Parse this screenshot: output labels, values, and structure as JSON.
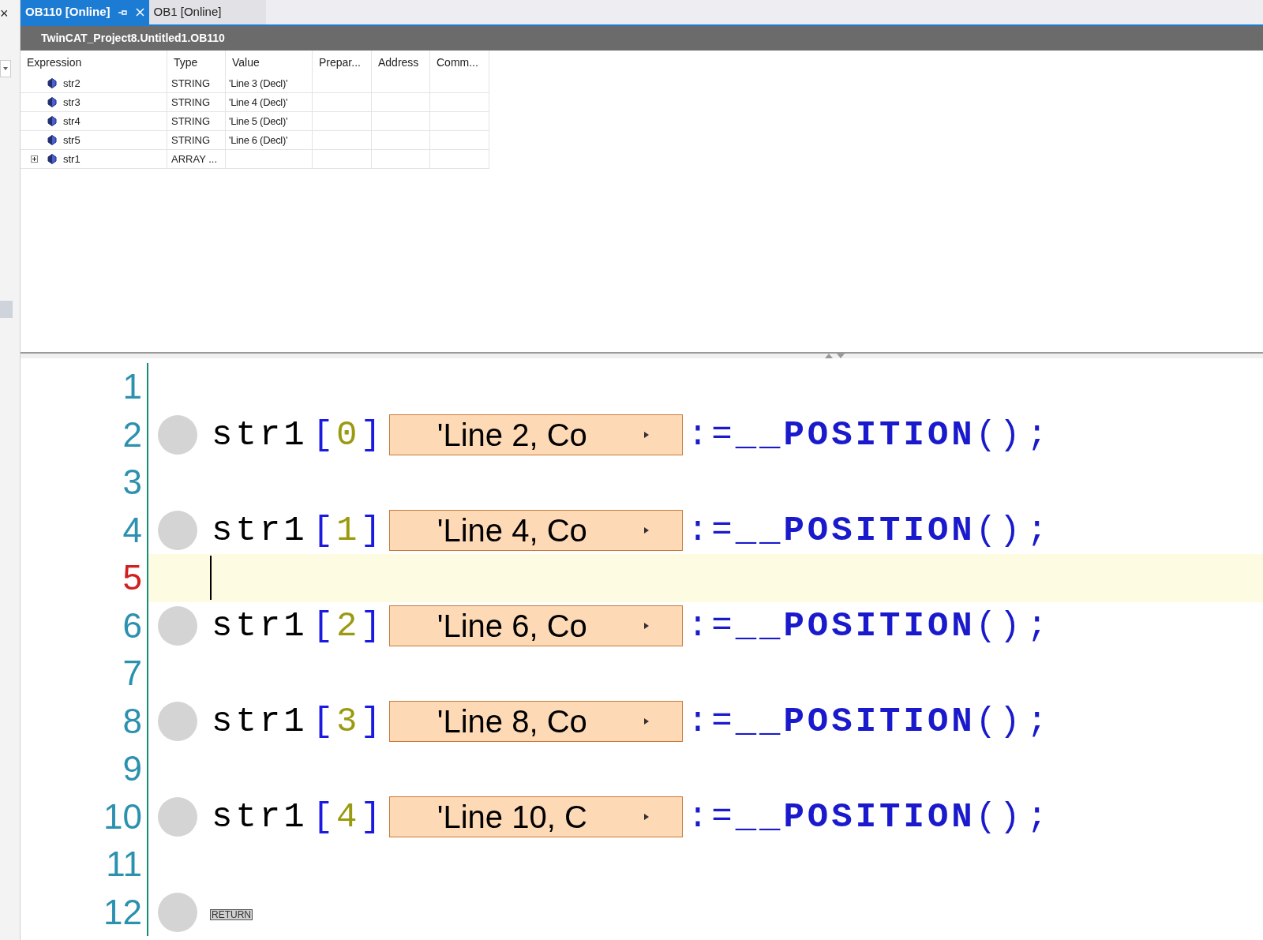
{
  "left_panel": {
    "close": "×"
  },
  "tabs": [
    {
      "label": "OB110 [Online]",
      "selected": true
    },
    {
      "label": "OB1 [Online]",
      "selected": false
    }
  ],
  "title_bar": {
    "title": "TwinCAT_Project8.Untitled1.OB110"
  },
  "watch_table": {
    "columns": [
      "Expression",
      "Type",
      "Value",
      "Prepar...",
      "Address",
      "Comm..."
    ],
    "rows": [
      {
        "expression": "str2",
        "type": "STRING",
        "value": "'Line 3 (Decl)'",
        "expandable": false
      },
      {
        "expression": "str3",
        "type": "STRING",
        "value": "'Line 4 (Decl)'",
        "expandable": false
      },
      {
        "expression": "str4",
        "type": "STRING",
        "value": "'Line 5 (Decl)'",
        "expandable": false
      },
      {
        "expression": "str5",
        "type": "STRING",
        "value": "'Line 6 (Decl)'",
        "expandable": false
      },
      {
        "expression": "str1",
        "type": "ARRAY ...",
        "value": "",
        "expandable": true
      }
    ]
  },
  "editor": {
    "lines": [
      {
        "number": "1",
        "kind": "empty",
        "current": false
      },
      {
        "number": "2",
        "kind": "assign",
        "current": false,
        "target": "str1",
        "open": "[",
        "index": "0",
        "close": "]",
        "monitor": "'Line 2, Co",
        "op": ":=",
        "call": "__POSITION",
        "parens": "()",
        "end": ";"
      },
      {
        "number": "3",
        "kind": "empty",
        "current": false
      },
      {
        "number": "4",
        "kind": "assign",
        "current": false,
        "target": "str1",
        "open": "[",
        "index": "1",
        "close": "]",
        "monitor": "'Line 4, Co",
        "op": ":=",
        "call": "__POSITION",
        "parens": "()",
        "end": ";"
      },
      {
        "number": "5",
        "kind": "empty",
        "current": true
      },
      {
        "number": "6",
        "kind": "assign",
        "current": false,
        "target": "str1",
        "open": "[",
        "index": "2",
        "close": "]",
        "monitor": "'Line 6, Co",
        "op": ":=",
        "call": "__POSITION",
        "parens": "()",
        "end": ";"
      },
      {
        "number": "7",
        "kind": "empty",
        "current": false
      },
      {
        "number": "8",
        "kind": "assign",
        "current": false,
        "target": "str1",
        "open": "[",
        "index": "3",
        "close": "]",
        "monitor": "'Line 8, Co",
        "op": ":=",
        "call": "__POSITION",
        "parens": "()",
        "end": ";"
      },
      {
        "number": "9",
        "kind": "empty",
        "current": false
      },
      {
        "number": "10",
        "kind": "assign",
        "current": false,
        "target": "str1",
        "open": "[",
        "index": "4",
        "close": "]",
        "monitor": "'Line 10, C",
        "op": ":=",
        "call": "__POSITION",
        "parens": "()",
        "end": ";"
      },
      {
        "number": "11",
        "kind": "empty",
        "current": false
      },
      {
        "number": "12",
        "kind": "return",
        "current": false,
        "keyword": "RETURN"
      }
    ]
  }
}
